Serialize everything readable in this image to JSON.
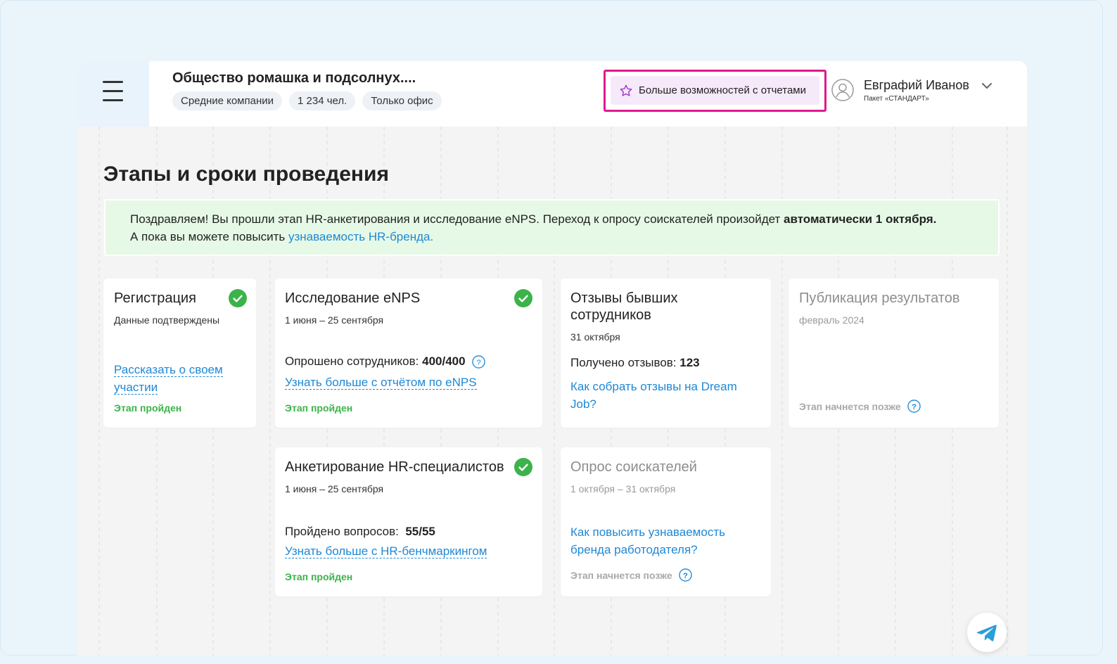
{
  "header": {
    "company_title": "Общество ромашка и подсолнух....",
    "chips": [
      "Средние компании",
      "1 234 чел.",
      "Только офис"
    ],
    "promo_label": "Больше возможностей с отчетами",
    "user_name": "Евграфий Иванов",
    "user_plan": "Пакет «СТАНДАРТ»"
  },
  "page_title": "Этапы и сроки проведения",
  "notice": {
    "line1_text": "Поздравляем! Вы прошли этап HR-анкетирования и исследование eNPS. Переход к опросу соискателей произойдет ",
    "line1_bold": "автоматически 1 октября.",
    "line2_text": "А пока вы можете повысить ",
    "line2_link": "узнаваемость HR-бренда."
  },
  "cards": {
    "registration": {
      "title": "Регистрация",
      "subtitle": "Данные подтверждены",
      "link_line1": "Рассказать о своем",
      "link_line2": "участии",
      "status": "Этап пройден"
    },
    "enps": {
      "title": "Исследование eNPS",
      "subtitle": "1 июня – 25 сентября",
      "stat_label": "Опрошено сотрудников:",
      "stat_value": "400/400",
      "link": "Узнать больше с отчётом по eNPS",
      "status": "Этап пройден"
    },
    "reviews": {
      "title_line1": "Отзывы бывших",
      "title_line2": "сотрудников",
      "subtitle": "31 октября",
      "stat_label": "Получено отзывов:",
      "stat_value": "123",
      "link_line1": "Как собрать отзывы на Dream",
      "link_line2": "Job?"
    },
    "publication": {
      "title": "Публикация результатов",
      "subtitle": "февраль 2024",
      "status": "Этап начнется позже"
    },
    "hr_survey": {
      "title": "Анкетирование HR-специалистов",
      "subtitle": "1 июня – 25 сентября",
      "stat_label": "Пройдено вопросов:",
      "stat_value": "55/55",
      "link": "Узнать больше с HR-бенчмаркингом",
      "status": "Этап пройден"
    },
    "candidates": {
      "title": "Опрос соискателей",
      "subtitle": "1 октября – 31 октября",
      "link_line1": "Как повысить узнаваемость",
      "link_line2": "бренда работодателя?",
      "status": "Этап начнется позже"
    }
  },
  "colors": {
    "accent_link": "#1e88d6",
    "done_green": "#3bb34a",
    "promo_border": "#e0198e",
    "notice_bg": "#e6f9e6"
  },
  "icons": [
    "menu-icon",
    "star-icon",
    "avatar-icon",
    "chevron-down-icon",
    "check-circle-icon",
    "question-icon",
    "telegram-icon"
  ]
}
